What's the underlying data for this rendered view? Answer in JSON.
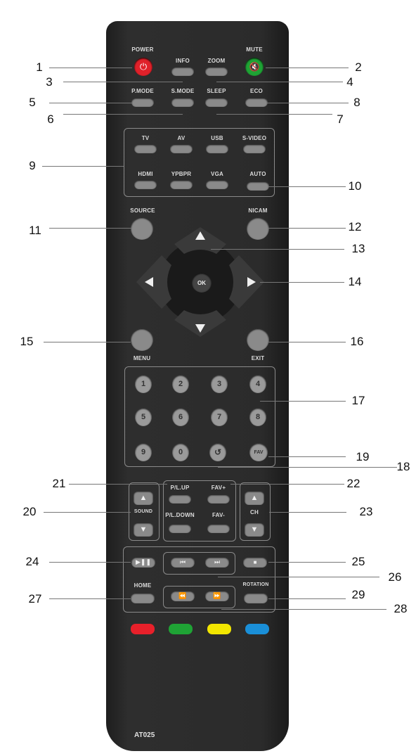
{
  "remote": {
    "model": "AT025",
    "buttons": {
      "power": "POWER",
      "mute": "MUTE",
      "info": "INFO",
      "zoom": "ZOOM",
      "pmode": "P.MODE",
      "smode": "S.MODE",
      "sleep": "SLEEP",
      "eco": "ECO",
      "tv": "TV",
      "av": "AV",
      "usb": "USB",
      "svideo": "S-VIDEO",
      "hdmi": "HDMI",
      "ypbpr": "YPBPR",
      "vga": "VGA",
      "auto": "AUTO",
      "source": "SOURCE",
      "nicam": "NICAM",
      "ok": "OK",
      "menu": "MENU",
      "exit": "EXIT",
      "digits": [
        "1",
        "2",
        "3",
        "4",
        "5",
        "6",
        "7",
        "8",
        "9",
        "0"
      ],
      "fav": "FAV",
      "pup": "P/L.UP",
      "pdown": "P/L.DOWN",
      "favplus": "FAV+",
      "favminus": "FAV-",
      "sound": "SOUND",
      "ch": "CH",
      "home": "HOME",
      "rotation": "ROTATION"
    },
    "colors": {
      "red": "#e8202a",
      "green": "#1fa335",
      "yellow": "#f2e600",
      "blue": "#1a8fd8"
    }
  },
  "callouts": [
    "1",
    "2",
    "3",
    "4",
    "5",
    "6",
    "7",
    "8",
    "9",
    "10",
    "11",
    "12",
    "13",
    "14",
    "15",
    "16",
    "17",
    "18",
    "19",
    "20",
    "21",
    "22",
    "23",
    "24",
    "25",
    "26",
    "27",
    "28",
    "29"
  ]
}
